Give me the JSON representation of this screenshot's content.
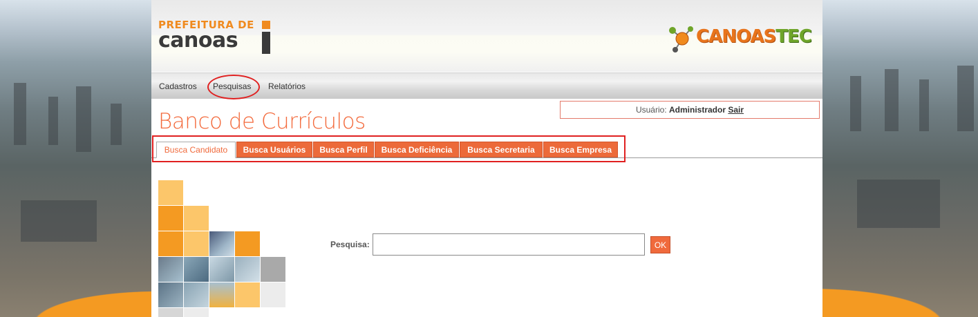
{
  "header": {
    "logo_left_line1": "PREFEITURA DE",
    "logo_left_line2": "canoas",
    "logo_right_a": "CANOAS",
    "logo_right_b": "TEC"
  },
  "menu": {
    "items": [
      {
        "label": "Cadastros"
      },
      {
        "label": "Pesquisas"
      },
      {
        "label": "Relatórios"
      }
    ]
  },
  "user": {
    "prefix": "Usuário:",
    "name": "Administrador",
    "logout": "Sair"
  },
  "page_title": "Banco de Currículos",
  "tabs": [
    {
      "label": "Busca Candidato",
      "active": true
    },
    {
      "label": "Busca Usuários",
      "active": false
    },
    {
      "label": "Busca Perfil",
      "active": false
    },
    {
      "label": "Busca Deficiência",
      "active": false
    },
    {
      "label": "Busca Secretaria",
      "active": false
    },
    {
      "label": "Busca Empresa",
      "active": false
    }
  ],
  "search": {
    "label": "Pesquisa:",
    "value": "",
    "button": "OK"
  },
  "colors": {
    "accent": "#ec6a3a",
    "annotation": "#e02020",
    "logo_orange": "#f08a1e",
    "logo_green": "#6fa52a"
  }
}
